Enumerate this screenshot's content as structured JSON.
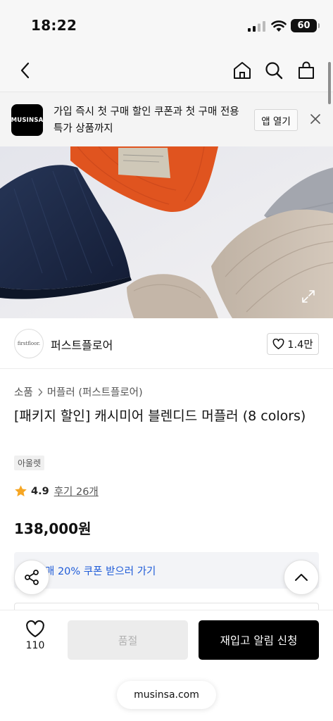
{
  "status_bar": {
    "time": "18:22",
    "battery": "60"
  },
  "banner": {
    "logo_text": "MUSINSA",
    "message": "가입 즉시 첫 구매 할인 쿠폰과 첫 구매 전용 특가 상품까지",
    "open_label": "앱 열기"
  },
  "brand": {
    "avatar_text": "firstfloor.",
    "name": "퍼스트플로어",
    "likes": "1.4만"
  },
  "product": {
    "breadcrumb": [
      "소품",
      "머플러 (퍼스트플로어)"
    ],
    "title": "[패키지 할인] 캐시미어 블렌디드 머플러 (8 colors)",
    "badge": "아울렛",
    "rating": "4.9",
    "reviews": "후기 26개",
    "price": "138,000원"
  },
  "coupon": {
    "text": "매 20% 쿠폰 받으러 가기"
  },
  "bottom": {
    "wish_count": "110",
    "soldout_label": "품절",
    "restock_label": "재입고 알림 신청",
    "url": "musinsa.com"
  },
  "colors": {
    "star": "#f6a623",
    "coupon_text": "#1e5bd8",
    "restock_bg": "#000000"
  }
}
